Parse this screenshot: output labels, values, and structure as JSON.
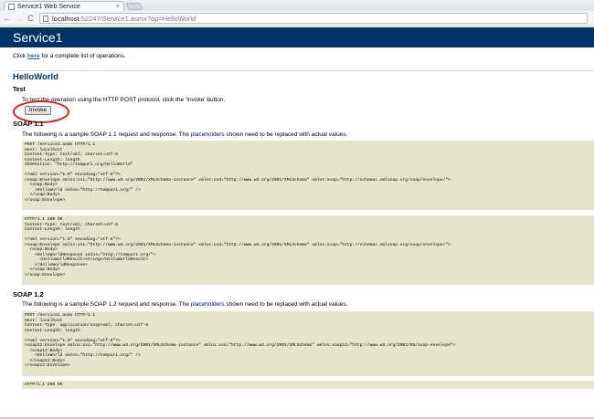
{
  "browser": {
    "tab_title": "Service1 Web Service",
    "tab_close": "×",
    "back": "←",
    "forward": "→",
    "reload": "C",
    "url_host": "localhost",
    "url_rest": ":52247/Service1.asmx?op=HelloWorld"
  },
  "header": {
    "title": "Service1"
  },
  "op_list_note": {
    "prefix": "Click ",
    "link": "here",
    "suffix": " for a complete list of operations."
  },
  "operation": {
    "name": "HelloWorld"
  },
  "test": {
    "heading": "Test",
    "description": "To test the operation using the HTTP POST protocol, click the 'Invoke' button.",
    "invoke_label": "Invoke"
  },
  "soap11": {
    "title": "SOAP 1.1",
    "desc_prefix": "The following is a sample SOAP 1.1 request and response. The ",
    "desc_placeholder": "placeholders",
    "desc_suffix": " shown need to be replaced with actual values.",
    "request": "POST /Service1.asmx HTTP/1.1\nHost: localhost\nContent-Type: text/xml; charset=utf-8\nContent-Length: length\nSOAPAction: \"http://tempuri.org/HelloWorld\"\n\n<?xml version=\"1.0\" encoding=\"utf-8\"?>\n<soap:Envelope xmlns:xsi=\"http://www.w3.org/2001/XMLSchema-instance\" xmlns:xsd=\"http://www.w3.org/2001/XMLSchema\" xmlns:soap=\"http://schemas.xmlsoap.org/soap/envelope/\">\n  <soap:Body>\n    <HelloWorld xmlns=\"http://tempuri.org/\" />\n  </soap:Body>\n</soap:Envelope>",
    "response": "HTTP/1.1 200 OK\nContent-Type: text/xml; charset=utf-8\nContent-Length: length\n\n<?xml version=\"1.0\" encoding=\"utf-8\"?>\n<soap:Envelope xmlns:xsi=\"http://www.w3.org/2001/XMLSchema-instance\" xmlns:xsd=\"http://www.w3.org/2001/XMLSchema\" xmlns:soap=\"http://schemas.xmlsoap.org/soap/envelope/\">\n  <soap:Body>\n    <HelloWorldResponse xmlns=\"http://tempuri.org/\">\n      <HelloWorldResult>string</HelloWorldResult>\n    </HelloWorldResponse>\n  </soap:Body>\n</soap:Envelope>"
  },
  "soap12": {
    "title": "SOAP 1.2",
    "desc_prefix": "The following is a sample SOAP 1.2 request and response. The ",
    "desc_placeholder": "placeholders",
    "desc_suffix": " shown need to be replaced with actual values.",
    "request": "POST /Service1.asmx HTTP/1.1\nHost: localhost\nContent-Type: application/soap+xml; charset=utf-8\nContent-Length: length\n\n<?xml version=\"1.0\" encoding=\"utf-8\"?>\n<soap12:Envelope xmlns:xsi=\"http://www.w3.org/2001/XMLSchema-instance\" xmlns:xsd=\"http://www.w3.org/2001/XMLSchema\" xmlns:soap12=\"http://www.w3.org/2003/05/soap-envelope\">\n  <soap12:Body>\n    <HelloWorld xmlns=\"http://tempuri.org/\" />\n  </soap12:Body>\n</soap12:Envelope>",
    "response": "HTTP/1.1 200 OK"
  },
  "colors": {
    "header_bg": "#003366",
    "code_bg": "#e5e5cc",
    "highlight": "#d42020",
    "placeholder_text": "#0000aa"
  }
}
